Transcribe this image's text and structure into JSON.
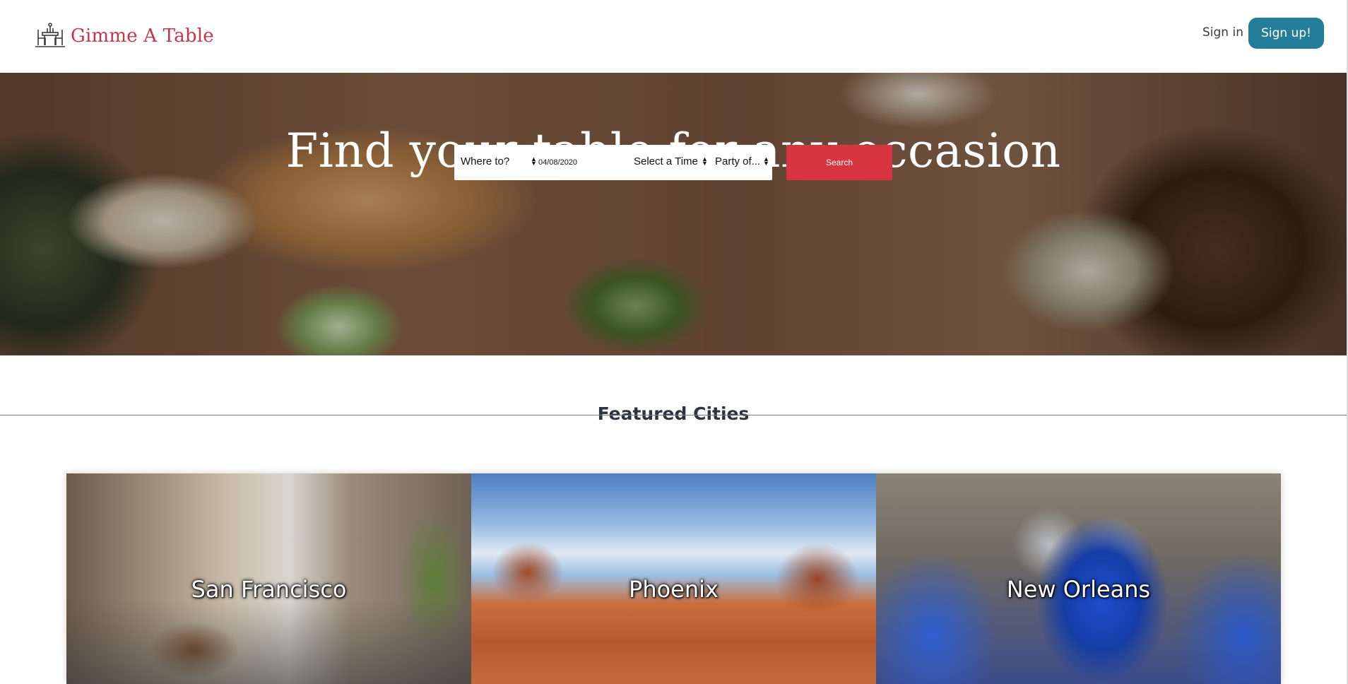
{
  "header": {
    "brand": "Gimme A Table",
    "logo_icon": "dining-table-icon",
    "signin_label": "Sign in",
    "signup_label": "Sign up!",
    "brand_color": "#c8354a",
    "signup_color": "#257e99"
  },
  "hero": {
    "title": "Find your table for any occasion",
    "search": {
      "where_placeholder": "Where to?",
      "date_value": "04/08/2020",
      "time_placeholder": "Select a Time",
      "party_placeholder": "Party of...",
      "button_label": "Search",
      "button_color": "#d7343f"
    }
  },
  "featured": {
    "title": "Featured Cities",
    "cities": [
      {
        "name": "San Francisco"
      },
      {
        "name": "Phoenix"
      },
      {
        "name": "New Orleans"
      }
    ]
  }
}
